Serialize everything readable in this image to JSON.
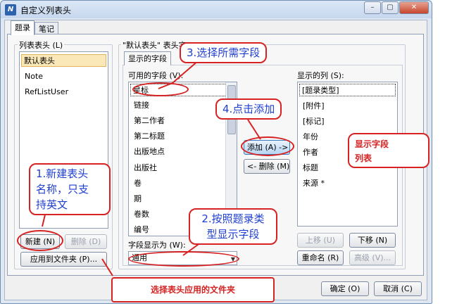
{
  "window": {
    "title": "自定义列表头",
    "minimize": "–",
    "maximize": "▢",
    "close": "✕"
  },
  "tabs": [
    "题录",
    "笔记"
  ],
  "list_headers": {
    "label": "列表表头 (L)",
    "items": [
      "默认表头",
      "Note",
      "RefListUser"
    ],
    "new_button": "新建 (N)",
    "delete_button": "删除 (D)",
    "apply_button": "应用到文件夹 (P)..."
  },
  "default_header": {
    "label": "\"默认表头\" 表头字",
    "inner_tab": "显示的字段",
    "available_label": "可用的字段 (V):",
    "available_fields": [
      "星标",
      "链接",
      "第二作者",
      "第二标题",
      "出版地点",
      "出版社",
      "卷",
      "期",
      "卷数",
      "编号"
    ],
    "display_label": "显示的列 (S):",
    "display_columns": [
      "[题录类型]",
      "[附件]",
      "[标记]",
      "年份",
      "作者",
      "标题",
      "来源 *"
    ],
    "add_button": "添加 (A) ->",
    "remove_button": "<- 删除 (M)",
    "field_display_as_label": "字段显示为 (W):",
    "field_display_as_value": "通用",
    "move_up_button": "上移 (U)",
    "move_down_button": "下移 (N)",
    "rename_button": "重命名 (R)",
    "advanced_button": "高级 (V)..."
  },
  "footer": {
    "ok": "确定 (O)",
    "cancel": "取消 (C)"
  },
  "annotations": {
    "select_fields": "3.选择所需字段",
    "click_add": "4.点击添加",
    "new_header_line1": "1.新建表头",
    "new_header_line2": "名称，只支",
    "new_header_line3": "持英文",
    "by_type_line1": "2.按照题录类",
    "by_type_line2": "型显示字段",
    "display_fields_line1": "显示字段",
    "display_fields_line2": "列表",
    "apply_folder": "选择表头应用的文件夹"
  },
  "colors": {
    "annotation_red": "#d62222",
    "annotation_blue": "#1f3fcf",
    "selection": "#fbe8b8"
  }
}
